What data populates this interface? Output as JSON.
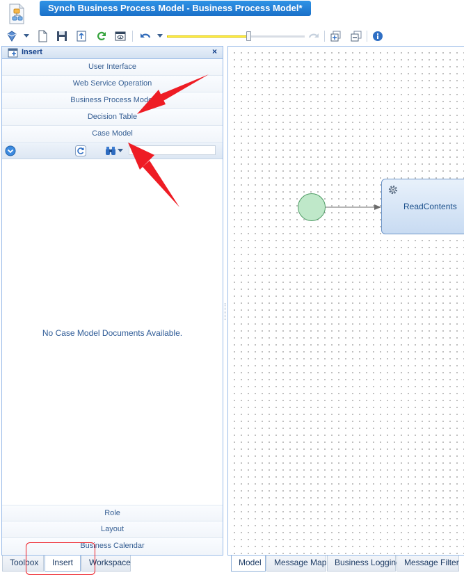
{
  "header": {
    "title": "Synch Business Process Model - Business Process Model*"
  },
  "toolbar": {
    "zoom_level": 0.6,
    "icons": [
      "publish-icon",
      "new-document-icon",
      "save-icon",
      "export-icon",
      "refresh-icon",
      "preview-icon",
      "undo-icon",
      "redo-icon",
      "add-page-icon",
      "copy-page-icon",
      "info-icon"
    ]
  },
  "insert_panel": {
    "title": "Insert",
    "close": "×",
    "top_items": [
      {
        "label": "User Interface"
      },
      {
        "label": "Web Service Operation"
      },
      {
        "label": "Business Process Model"
      },
      {
        "label": "Decision Table"
      },
      {
        "label": "Case Model"
      }
    ],
    "empty_message": "No Case Model Documents Available.",
    "bottom_items": [
      {
        "label": "Role"
      },
      {
        "label": "Layout"
      },
      {
        "label": "Business Calendar"
      }
    ]
  },
  "left_tabs": [
    {
      "label": "Toolbox",
      "active": false
    },
    {
      "label": "Insert",
      "active": true
    },
    {
      "label": "Workspace",
      "active": false
    }
  ],
  "canvas": {
    "task_label": "ReadContents"
  },
  "right_tabs": [
    {
      "label": "Model",
      "active": true
    },
    {
      "label": "Message Map",
      "active": false
    },
    {
      "label": "Business Logging",
      "active": false
    },
    {
      "label": "Message Filter",
      "active": false
    }
  ],
  "colors": {
    "title_bar": "#1a70c8",
    "panel_border": "#99bbe8",
    "start_event": "#bfe8c9",
    "task_fill": "#c8dbf2",
    "annotation": "#ee1c24"
  }
}
